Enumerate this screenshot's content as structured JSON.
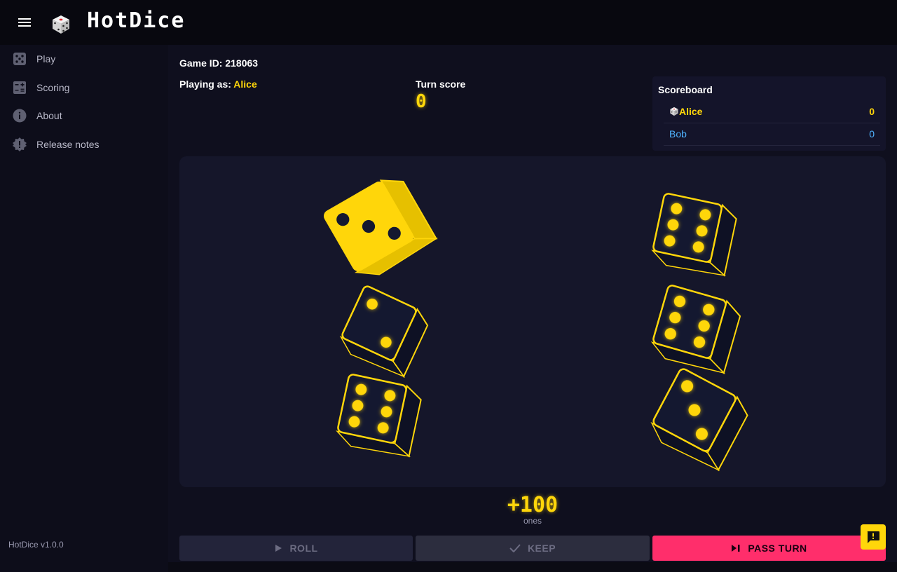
{
  "app": {
    "title": "HotDice",
    "version": "HotDice v1.0.0"
  },
  "sidebar": {
    "items": [
      {
        "label": "Play",
        "icon": "dice-icon"
      },
      {
        "label": "Scoring",
        "icon": "calculator-icon"
      },
      {
        "label": "About",
        "icon": "info-icon"
      },
      {
        "label": "Release notes",
        "icon": "alert-badge-icon"
      }
    ]
  },
  "game": {
    "id_label": "Game ID: 218063",
    "playing_prefix": "Playing as:",
    "player_name": "Alice",
    "turn_label": "Turn score",
    "turn_score": "0"
  },
  "scoreboard": {
    "title": "Scoreboard",
    "rows": [
      {
        "name": "Alice",
        "score": "0",
        "active": true,
        "color": "#ffd60a"
      },
      {
        "name": "Bob",
        "score": "0",
        "active": false,
        "color": "#4fb3ff"
      }
    ]
  },
  "dice": [
    {
      "value": 3,
      "held": true
    },
    {
      "value": 2,
      "held": false
    },
    {
      "value": 6,
      "held": false
    },
    {
      "value": 6,
      "held": false
    },
    {
      "value": 6,
      "held": false
    },
    {
      "value": 3,
      "held": false
    }
  ],
  "result": {
    "points": "+100",
    "label": "ones"
  },
  "actions": {
    "roll": "ROLL",
    "keep": "KEEP",
    "pass": "PASS TURN"
  },
  "colors": {
    "accent": "#ffd60a",
    "pass": "#ff2e6b",
    "board": "#15162a"
  }
}
